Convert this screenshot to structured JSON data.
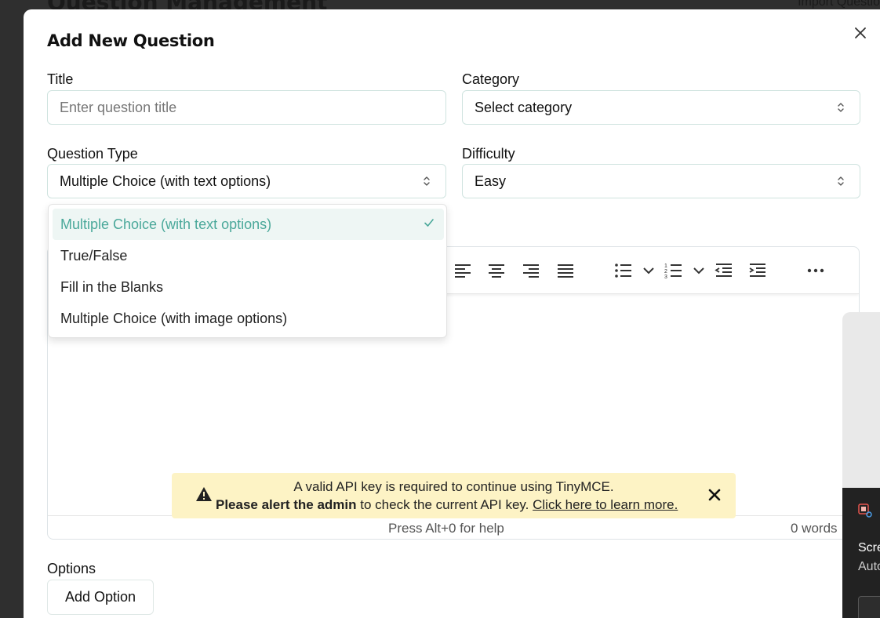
{
  "background": {
    "page_title": "Question Management",
    "import_label": "Import Questio"
  },
  "modal": {
    "title": "Add New Question",
    "title_field": {
      "label": "Title",
      "placeholder": "Enter question title"
    },
    "category_field": {
      "label": "Category",
      "value": "Select category"
    },
    "question_type_field": {
      "label": "Question Type",
      "value": "Multiple Choice (with text options)",
      "options": [
        "Multiple Choice (with text options)",
        "True/False",
        "Fill in the Blanks",
        "Multiple Choice (with image options)"
      ],
      "selected_index": 0
    },
    "difficulty_field": {
      "label": "Difficulty",
      "value": "Easy"
    },
    "editor": {
      "status_help": "Press Alt+0 for help",
      "word_count": "0 words",
      "warning": {
        "line1": "A valid API key is required to continue using TinyMCE.",
        "bold": "Please alert the admin",
        "middle": " to check the current API key. ",
        "link": "Click here to learn more."
      }
    },
    "options_section": {
      "label": "Options",
      "add_button": "Add Option"
    }
  },
  "side_notification": {
    "line1": "Scre",
    "line2": "Auto"
  },
  "colors": {
    "accent": "#4aa89a",
    "selected_bg": "#eef6f4",
    "warning_bg": "#fdf3c5",
    "field_border": "#cfe3df"
  }
}
